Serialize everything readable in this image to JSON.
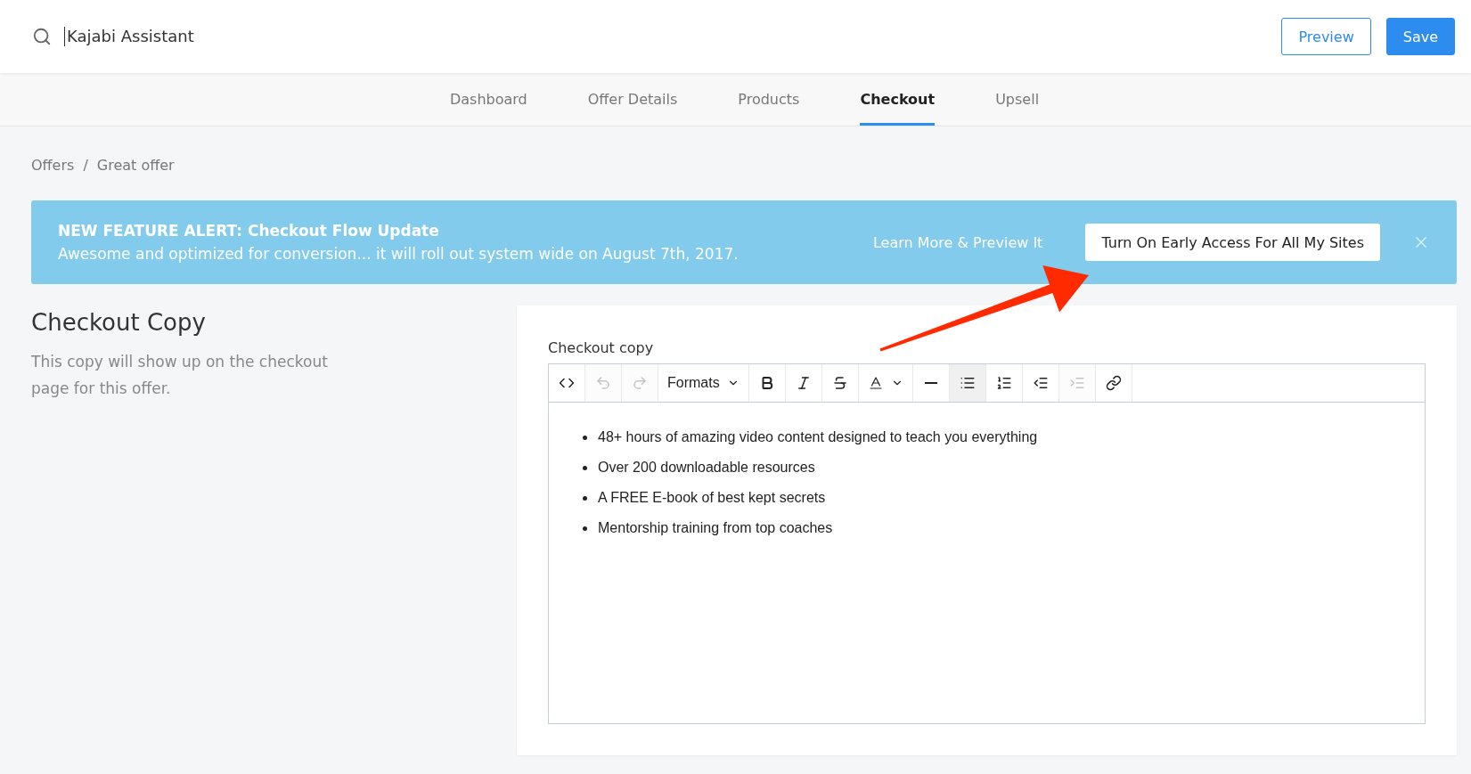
{
  "header": {
    "search": {
      "value": "Kajabi Assistant"
    },
    "buttons": [
      {
        "label": "Preview",
        "kind": "outline"
      },
      {
        "label": "Save",
        "kind": "primary"
      }
    ]
  },
  "tabs": [
    {
      "label": "Dashboard",
      "selected": false
    },
    {
      "label": "Offer Details",
      "selected": false
    },
    {
      "label": "Products",
      "selected": false
    },
    {
      "label": "Checkout",
      "selected": true
    },
    {
      "label": "Upsell",
      "selected": false
    }
  ],
  "breadcrumb": {
    "separator": "/",
    "items": [
      "Offers",
      "Great offer"
    ]
  },
  "banner": {
    "title": "NEW FEATURE ALERT: Checkout Flow Update",
    "message": "Awesome and optimized for conversion... it will roll out system wide on August 7th, 2017.",
    "link": "Learn More & Preview It",
    "button": "Turn On Early Access For All My Sites"
  },
  "section": {
    "title": "Checkout Copy",
    "description": "This copy will show up on the checkout page for this offer."
  },
  "editor": {
    "label": "Checkout copy",
    "tools": [
      {
        "kind": "code",
        "disabled": false,
        "active": false
      },
      {
        "kind": "undo",
        "disabled": true,
        "active": false
      },
      {
        "kind": "redo",
        "disabled": true,
        "active": false
      },
      {
        "kind": "formats",
        "label": "Formats",
        "disabled": false,
        "active": false
      },
      {
        "kind": "bold",
        "disabled": false,
        "active": false
      },
      {
        "kind": "italic",
        "disabled": false,
        "active": false
      },
      {
        "kind": "strike",
        "disabled": false,
        "active": false
      },
      {
        "kind": "color",
        "disabled": false,
        "active": false
      },
      {
        "kind": "rule",
        "disabled": false,
        "active": false
      },
      {
        "kind": "bullets",
        "disabled": false,
        "active": true
      },
      {
        "kind": "numbers",
        "disabled": false,
        "active": false
      },
      {
        "kind": "outdent",
        "disabled": false,
        "active": false
      },
      {
        "kind": "indent",
        "disabled": true,
        "active": false
      },
      {
        "kind": "link",
        "disabled": false,
        "active": false
      }
    ],
    "items": [
      "48+ hours of amazing video content designed to teach you everything",
      "Over 200 downloadable resources",
      "A FREE E-book of best kept secrets",
      "Mentorship training from top coaches"
    ]
  }
}
